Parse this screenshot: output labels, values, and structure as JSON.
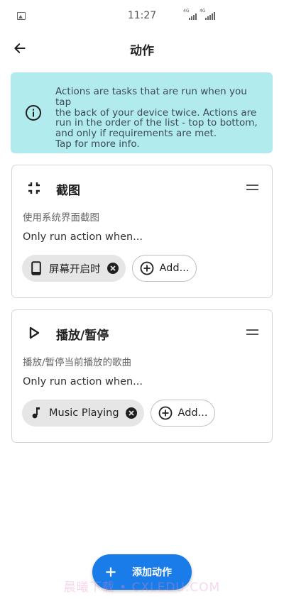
{
  "status_bar": {
    "time": "11:27",
    "signal_1_tag": "4G",
    "signal_2_tag": "4G"
  },
  "app_bar": {
    "title": "动作",
    "back_icon": "arrow-left-icon"
  },
  "info_banner": {
    "icon": "info-circle-icon",
    "text_lines": [
      "Actions are tasks that are run when you tap",
      "the back of your device twice. Actions are",
      "run in the order of the list - top to bottom,",
      "and only if requirements are met.",
      "Tap for more info."
    ],
    "background": "#b2ebee"
  },
  "actions": [
    {
      "icon": "collapse-screenshot-icon",
      "title": "截图",
      "description": "使用系统界面截图",
      "requirements_label": "Only run action when...",
      "requirement": {
        "icon": "phone-icon",
        "label": "屏幕开启时"
      },
      "add_label": "Add..."
    },
    {
      "icon": "play-icon",
      "title": "播放/暂停",
      "description": "播放/暂停当前播放的歌曲",
      "requirements_label": "Only run action when...",
      "requirement": {
        "icon": "music-note-icon",
        "label": "Music Playing"
      },
      "add_label": "Add..."
    }
  ],
  "fab": {
    "label": "添加动作",
    "icon": "plus-icon",
    "color": "#1a7ce8"
  },
  "watermark": "晨曦下载 • CXLEDU.COM"
}
